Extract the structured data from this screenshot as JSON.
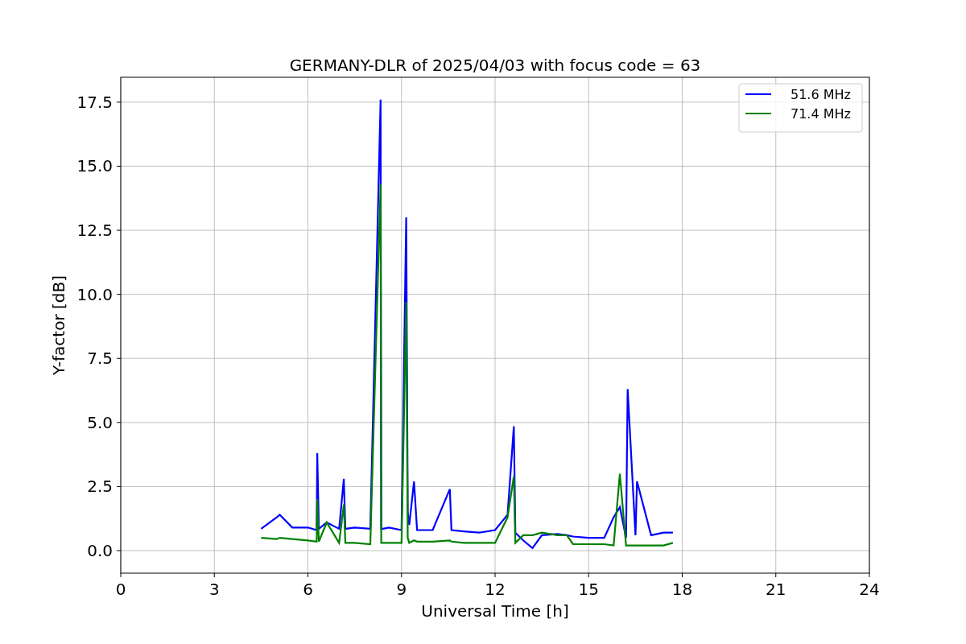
{
  "figure": {
    "chart_data": {
      "type": "line",
      "title": "GERMANY-DLR of 2025/04/03 with focus code = 63",
      "xlabel": "Universal Time [h]",
      "ylabel": "Y-factor [dB]",
      "x": [
        4.5,
        5.0,
        5.1,
        5.5,
        6.0,
        6.28,
        6.3,
        6.35,
        6.6,
        7.0,
        7.15,
        7.2,
        7.5,
        8.0,
        8.33,
        8.35,
        8.4,
        8.6,
        9.0,
        9.15,
        9.2,
        9.25,
        9.4,
        9.5,
        10.0,
        10.55,
        10.6,
        11.0,
        11.5,
        12.0,
        12.4,
        12.6,
        12.65,
        12.9,
        13.2,
        13.5,
        14.0,
        14.3,
        14.5,
        15.0,
        15.5,
        15.8,
        16.0,
        16.2,
        16.25,
        16.5,
        16.55,
        17.0,
        17.4,
        17.7
      ],
      "series": [
        {
          "name": "51.6 MHz",
          "color": "#0000ff",
          "values": [
            0.85,
            1.3,
            1.4,
            0.9,
            0.9,
            0.8,
            3.8,
            0.85,
            1.1,
            0.85,
            2.8,
            0.85,
            0.9,
            0.85,
            17.6,
            0.85,
            0.85,
            0.9,
            0.8,
            13.0,
            1.5,
            1.0,
            2.7,
            0.8,
            0.8,
            2.4,
            0.8,
            0.75,
            0.7,
            0.8,
            1.4,
            4.85,
            0.7,
            0.4,
            0.1,
            0.6,
            0.65,
            0.6,
            0.55,
            0.5,
            0.5,
            1.3,
            1.7,
            0.5,
            6.3,
            0.6,
            2.7,
            0.6,
            0.7,
            0.7
          ]
        },
        {
          "name": "71.4 MHz",
          "color": "#008000",
          "values": [
            0.5,
            0.45,
            0.5,
            0.45,
            0.4,
            0.35,
            2.0,
            0.35,
            1.1,
            0.3,
            1.8,
            0.3,
            0.3,
            0.25,
            14.3,
            0.3,
            0.3,
            0.3,
            0.3,
            9.7,
            0.5,
            0.3,
            0.4,
            0.35,
            0.35,
            0.4,
            0.35,
            0.3,
            0.3,
            0.3,
            1.3,
            2.9,
            0.3,
            0.6,
            0.6,
            0.7,
            0.6,
            0.6,
            0.25,
            0.25,
            0.25,
            0.2,
            3.0,
            0.2,
            0.2,
            0.2,
            0.2,
            0.2,
            0.2,
            0.3
          ]
        }
      ],
      "grid": true,
      "legend": true,
      "xlim": [
        0,
        24
      ],
      "ylim": [
        -0.88,
        18.47
      ],
      "xticks": [
        0,
        3,
        6,
        9,
        12,
        15,
        18,
        21,
        24
      ],
      "yticks": [
        {
          "value": 0,
          "label": "0.0"
        },
        {
          "value": 2.5,
          "label": "2.5"
        },
        {
          "value": 5,
          "label": "5.0"
        },
        {
          "value": 7.5,
          "label": "7.5"
        },
        {
          "value": 10,
          "label": "10.0"
        },
        {
          "value": 12.5,
          "label": "12.5"
        },
        {
          "value": 15,
          "label": "15.0"
        },
        {
          "value": 17.5,
          "label": "17.5"
        }
      ]
    }
  }
}
